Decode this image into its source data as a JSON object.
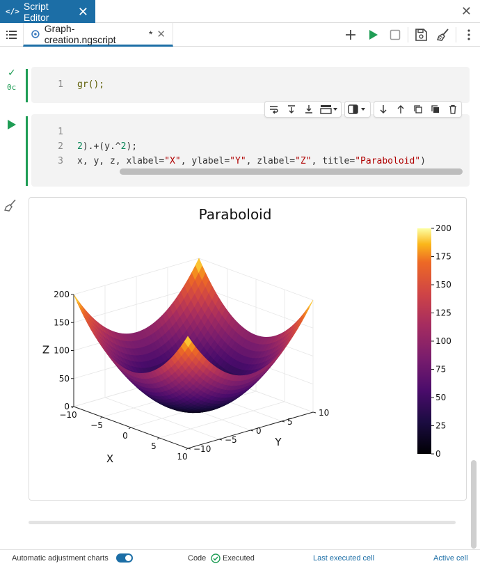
{
  "app": {
    "title": "Script Editor",
    "close_glyph": "✕"
  },
  "tabbar": {
    "file_tab": {
      "label": "Graph-creation.ngscript",
      "modified": "*",
      "close": "✕"
    }
  },
  "cells": [
    {
      "status": "✓",
      "time": "0c",
      "lines": [
        {
          "num": "1",
          "text": "gr();"
        }
      ]
    },
    {
      "lines": [
        {
          "num": "1",
          "text": ""
        },
        {
          "num": "2",
          "text": "2).+(y.^2);"
        },
        {
          "num": "3",
          "text": "x, y, z, xlabel=\"X\", ylabel=\"Y\", zlabel=\"Z\", title=\"Paraboloid\")"
        }
      ]
    }
  ],
  "colors": {
    "accent": "#1c6ea6",
    "run": "#1f9d55"
  },
  "chart_data": {
    "type": "surface",
    "title": "Paraboloid",
    "xlabel": "X",
    "ylabel": "Y",
    "zlabel": "Z",
    "xlim": [
      -10,
      10
    ],
    "ylim": [
      -10,
      10
    ],
    "zlim": [
      0,
      200
    ],
    "x_ticks": [
      "−10",
      "−5",
      "0",
      "5",
      "10"
    ],
    "y_ticks": [
      "−10",
      "−5",
      "0",
      "5",
      "10"
    ],
    "z_ticks": [
      "0",
      "50",
      "100",
      "150",
      "200"
    ],
    "colorbar": {
      "ticks": [
        "0",
        "25",
        "50",
        "75",
        "100",
        "125",
        "150",
        "175",
        "200"
      ],
      "range": [
        0,
        200
      ],
      "colormap": "inferno"
    },
    "function": "z = x^2 + y^2"
  },
  "statusbar": {
    "auto_adjust_label": "Automatic adjustment charts",
    "code_label": "Code",
    "executed_label": "Executed",
    "last_executed": "Last executed cell",
    "active_cell": "Active cell"
  }
}
